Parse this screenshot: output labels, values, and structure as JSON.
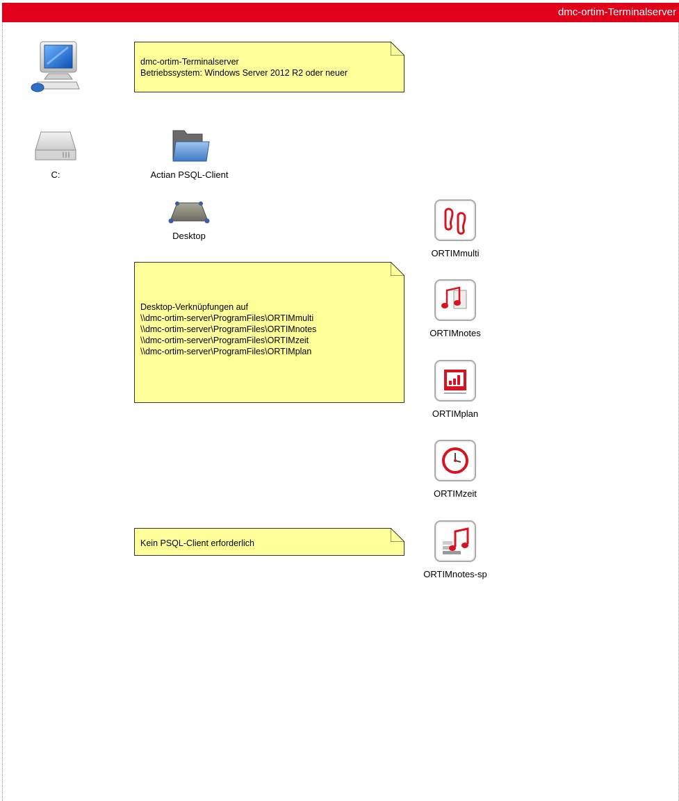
{
  "title": "dmc-ortim-Terminalserver",
  "nodes": {
    "drive_c": "C:",
    "psql_client": "Actian PSQL-Client",
    "desktop": "Desktop"
  },
  "notes": {
    "server": {
      "line1": "dmc-ortim-Terminalserver",
      "line2": "Betriebssystem: Windows Server 2012 R2 oder neuer"
    },
    "shortcuts": {
      "line1": "Desktop-Verknüpfungen auf",
      "line2": "\\\\dmc-ortim-server\\ProgramFiles\\ORTIMmulti",
      "line3": "\\\\dmc-ortim-server\\ProgramFiles\\ORTIMnotes",
      "line4": "\\\\dmc-ortim-server\\ProgramFiles\\ORTIMzeit",
      "line5": "\\\\dmc-ortim-server\\ProgramFiles\\ORTIMplan"
    },
    "no_psql": "Kein PSQL-Client erforderlich"
  },
  "apps": {
    "multi": "ORTIMmulti",
    "notes": "ORTIMnotes",
    "plan": "ORTIMplan",
    "zeit": "ORTIMzeit",
    "notes_sp": "ORTIMnotes-sp"
  },
  "colors": {
    "title_bar": "#e0001a",
    "note_fill": "#ffff99",
    "app_accent": "#d8121f"
  },
  "icons": {
    "server": "computer-icon",
    "drive": "hard-drive-icon",
    "folder": "folder-icon",
    "desktop": "desktop-icon",
    "multi": "footprints-icon",
    "notes": "music-notes-document-icon",
    "plan": "chart-presentation-icon",
    "zeit": "clock-icon",
    "notes_sp": "music-note-stack-icon"
  }
}
